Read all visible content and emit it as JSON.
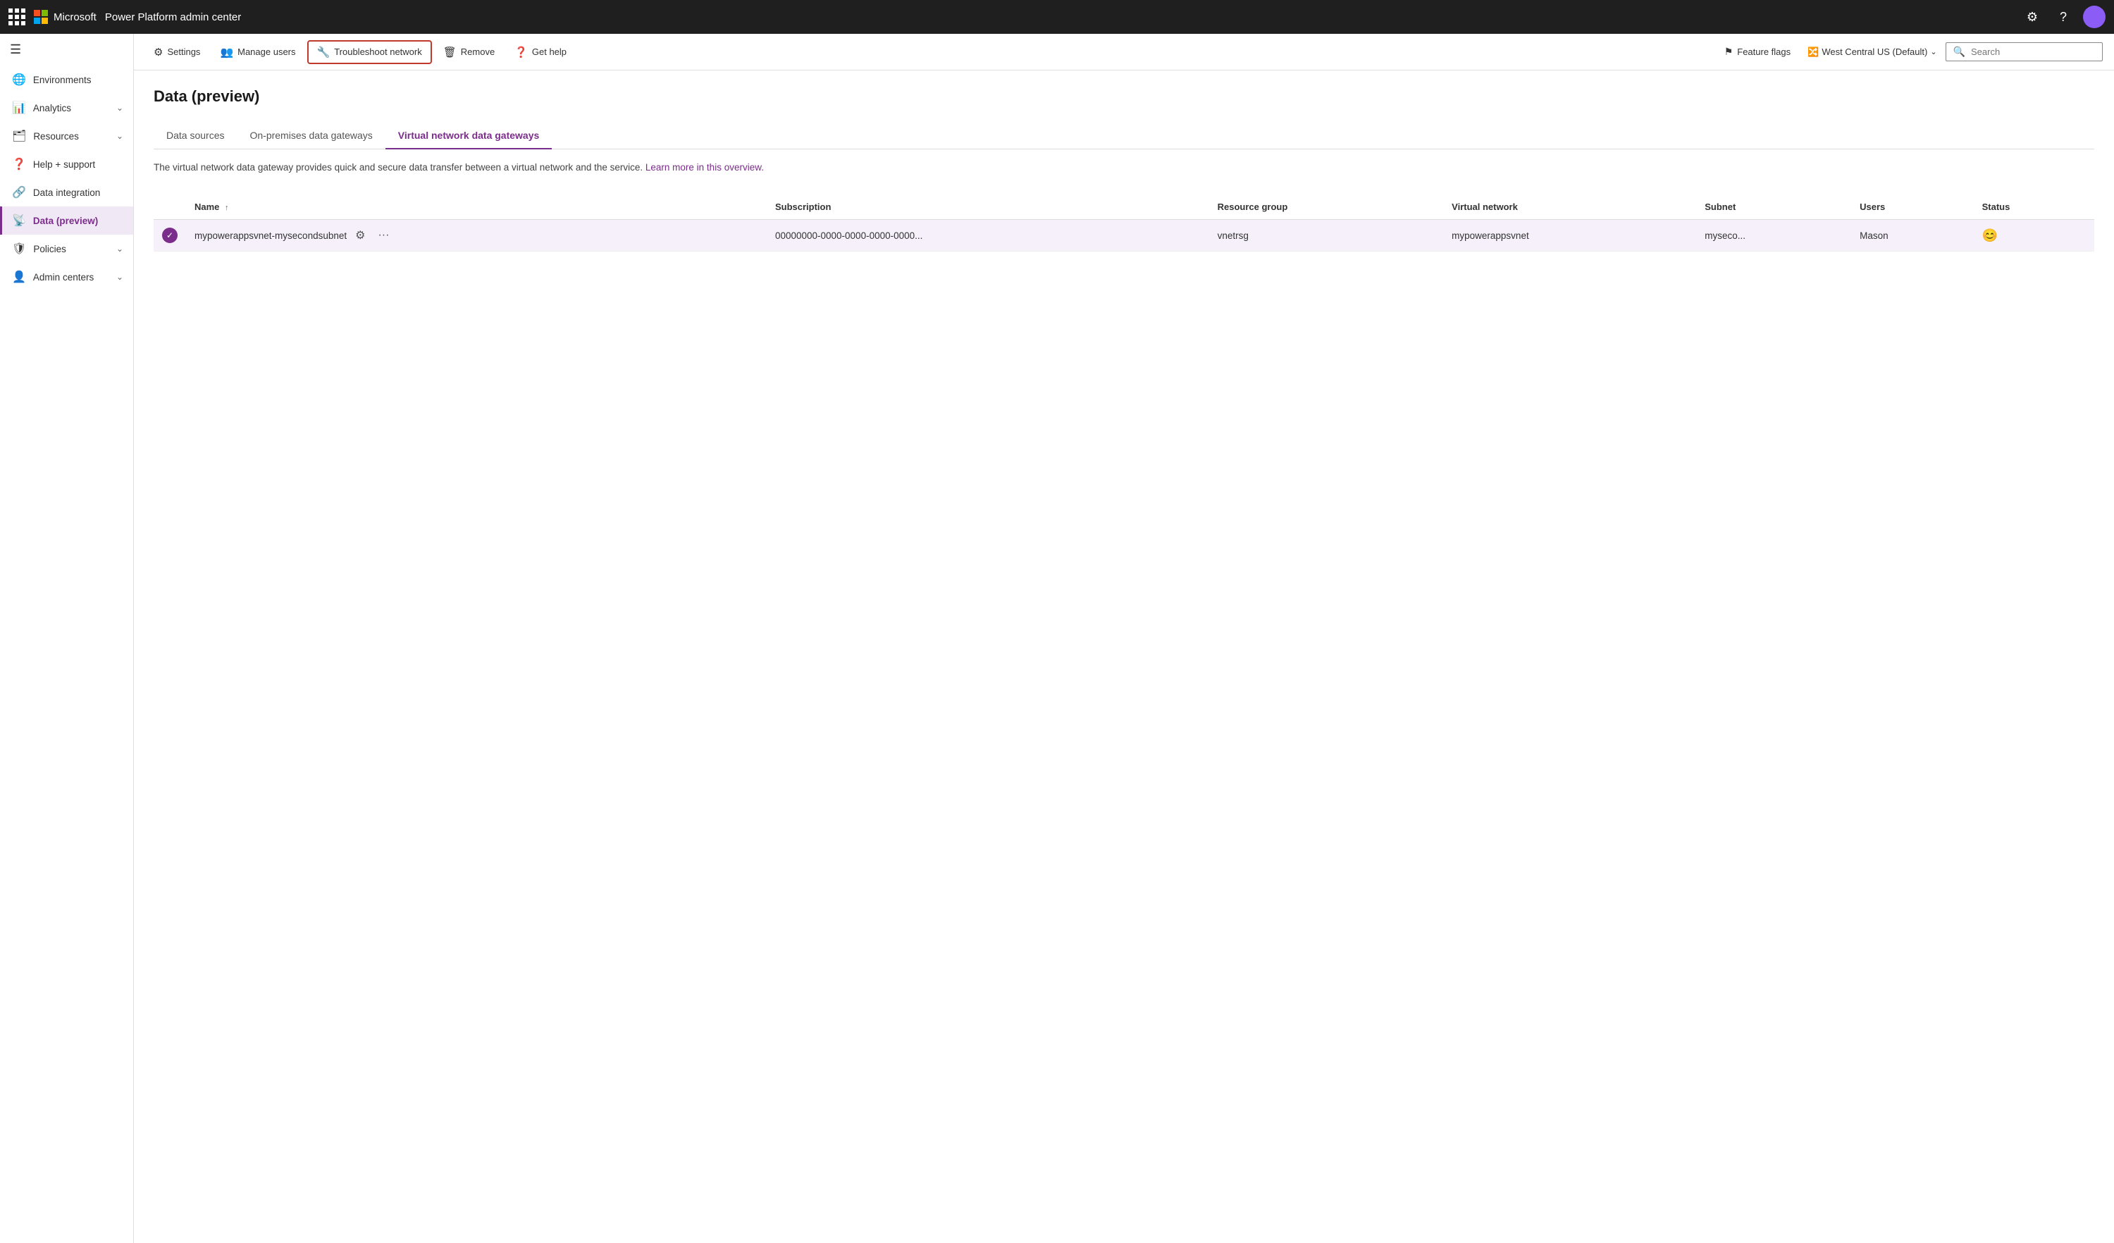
{
  "app": {
    "title": "Power Platform admin center"
  },
  "topbar": {
    "settings_icon": "⚙",
    "help_icon": "?",
    "avatar_initials": ""
  },
  "sidebar": {
    "items": [
      {
        "id": "environments",
        "label": "Environments",
        "icon": "🌐",
        "has_chevron": false
      },
      {
        "id": "analytics",
        "label": "Analytics",
        "icon": "📊",
        "has_chevron": true
      },
      {
        "id": "resources",
        "label": "Resources",
        "icon": "🗂",
        "has_chevron": true
      },
      {
        "id": "help-support",
        "label": "Help + support",
        "icon": "❓",
        "has_chevron": false
      },
      {
        "id": "data-integration",
        "label": "Data integration",
        "icon": "🔗",
        "has_chevron": false
      },
      {
        "id": "data-preview",
        "label": "Data (preview)",
        "icon": "📡",
        "has_chevron": false,
        "active": true
      },
      {
        "id": "policies",
        "label": "Policies",
        "icon": "🛡",
        "has_chevron": true
      },
      {
        "id": "admin-centers",
        "label": "Admin centers",
        "icon": "👤",
        "has_chevron": true
      }
    ]
  },
  "toolbar": {
    "settings_label": "Settings",
    "manage_users_label": "Manage users",
    "troubleshoot_network_label": "Troubleshoot network",
    "remove_label": "Remove",
    "get_help_label": "Get help",
    "feature_flags_label": "Feature flags",
    "region_label": "West Central US (Default)",
    "search_placeholder": "Search"
  },
  "page": {
    "title": "Data (preview)",
    "tabs": [
      {
        "id": "data-sources",
        "label": "Data sources"
      },
      {
        "id": "on-premises",
        "label": "On-premises data gateways"
      },
      {
        "id": "virtual-network",
        "label": "Virtual network data gateways",
        "active": true
      }
    ],
    "description": "The virtual network data gateway provides quick and secure data transfer between a virtual network and the service.",
    "learn_more_link": "Learn more in this overview.",
    "table": {
      "columns": [
        {
          "id": "checkbox",
          "label": ""
        },
        {
          "id": "name",
          "label": "Name",
          "sortable": true
        },
        {
          "id": "subscription",
          "label": "Subscription"
        },
        {
          "id": "resource-group",
          "label": "Resource group"
        },
        {
          "id": "virtual-network",
          "label": "Virtual network"
        },
        {
          "id": "subnet",
          "label": "Subnet"
        },
        {
          "id": "users",
          "label": "Users"
        },
        {
          "id": "status",
          "label": "Status"
        }
      ],
      "rows": [
        {
          "name": "mypowerappsvnet-mysecondsubnet",
          "subscription": "00000000-0000-0000-0000-0000...",
          "resource_group": "vnetrsg",
          "virtual_network": "mypowerappsvnet",
          "subnet": "myseco...",
          "users": "Mason",
          "status": "😊",
          "selected": true
        }
      ]
    }
  }
}
